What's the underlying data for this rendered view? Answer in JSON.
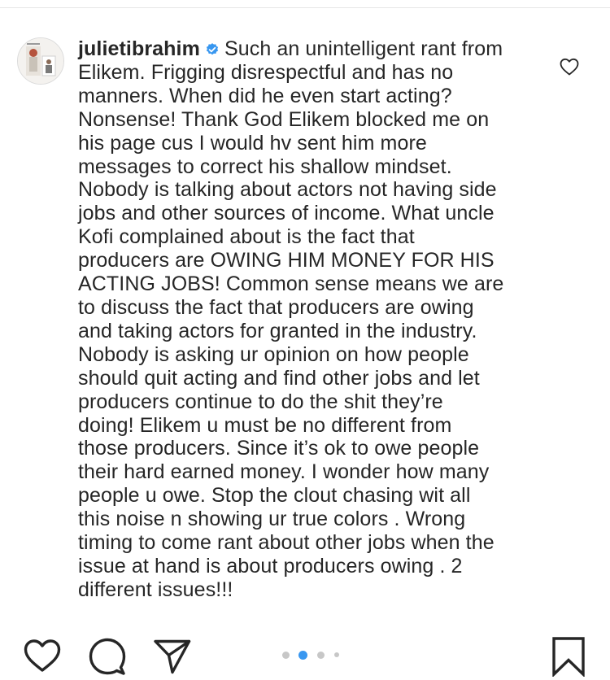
{
  "post": {
    "username": "julietibrahim",
    "comment_lines": [
      "Such an unintelligent rant from",
      "Elikem. Frigging disrespectful and has no",
      "manners. When did he even start acting?",
      "Nonsense! Thank God Elikem blocked me on",
      "his page cus I would hv sent him more",
      "messages to correct his shallow mindset.",
      "Nobody is talking about actors not having side",
      "jobs and other sources of income. What uncle",
      "Kofi complained about is the fact that",
      "producers are OWING HIM MONEY FOR HIS",
      "ACTING JOBS! Common sense means we are",
      "to discuss the fact that producers are owing",
      "and taking actors for granted in the industry.",
      "Nobody is asking ur opinion on how people",
      "should quit acting and find other jobs and let",
      "producers continue to do the shit they’re",
      "doing! Elikem u must be no different from",
      "those producers. Since it’s ok to owe people",
      "their hard earned money. I wonder how many",
      "people u owe. Stop the clout chasing wit all",
      "this noise n showing ur true colors . Wrong",
      "timing to come rant about other jobs when the",
      "issue at hand is about producers owing . 2",
      "different issues!!!"
    ]
  },
  "icons": {
    "like": "heart-outline",
    "comment": "speech-bubble",
    "share": "paper-plane",
    "save": "bookmark",
    "verified": "verified-badge"
  },
  "carousel": {
    "count": 4,
    "active_index": 1
  },
  "colors": {
    "verified": "#3897f0",
    "active_dot": "#3897f0",
    "inactive_dot": "#c7c7c7",
    "text": "#262626"
  }
}
